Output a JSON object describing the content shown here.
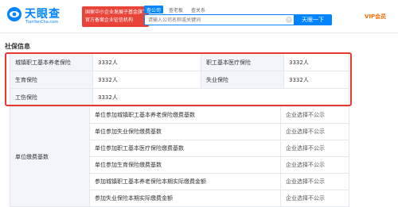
{
  "header": {
    "logo_cn": "天眼查",
    "logo_en": "TianYanCha.com",
    "badge_line1": "国家中小企业发展子基金旗下",
    "badge_line2": "官方备案企业征信机构",
    "tabs": [
      "查公司",
      "查老板",
      "查关系"
    ],
    "search_placeholder": "请输入公司名称或关键词",
    "search_button": "天眼一下",
    "vip_label": "VIP会员"
  },
  "section_title": "社保信息",
  "summary": [
    {
      "label": "城镇职工基本养老保险",
      "value": "3332人",
      "label2": "职工基本医疗保险",
      "value2": "3332人"
    },
    {
      "label": "生育保险",
      "value": "3332人",
      "label2": "失业保险",
      "value2": "3332人"
    },
    {
      "label": "工伤保险",
      "value": "3332人"
    }
  ],
  "contributions": {
    "group_label": "单位缴费基数",
    "rows": [
      {
        "item": "单位参加城镇职工基本养老保险缴费基数",
        "status": "企业选择不公示"
      },
      {
        "item": "单位参加失业保险缴费基数",
        "status": "企业选择不公示"
      },
      {
        "item": "单位参加职工基本医疗保险缴费基数",
        "status": "企业选择不公示"
      },
      {
        "item": "单位参加生育保险缴费基数",
        "status": "企业选择不公示"
      },
      {
        "item": "参加城镇职工基本养老保险本期实际缴费金额",
        "status": "企业选择不公示"
      },
      {
        "item": "参加失业保险本期实际缴费金额",
        "status": "企业选择不公示"
      }
    ]
  },
  "colors": {
    "brand": "#0084ff",
    "badge": "#e8443a",
    "highlight": "#e5382f",
    "vip": "#ff6c00"
  }
}
